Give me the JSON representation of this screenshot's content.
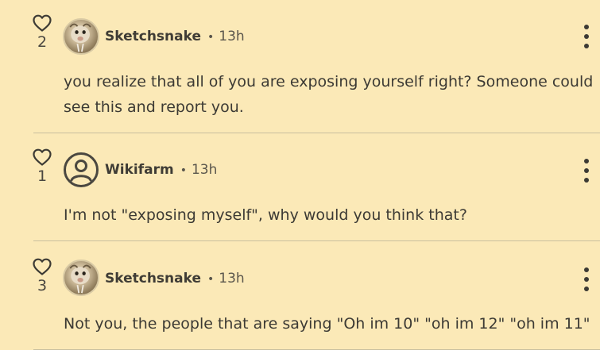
{
  "comments": [
    {
      "likes": "2",
      "avatar": "pet-photo-avatar",
      "username": "Sketchsnake",
      "separator": "•",
      "time": "13h",
      "text": " you realize that all of you are exposing yourself right? Someone could see this and report you.",
      "menu_icon": "more-vertical-icon"
    },
    {
      "likes": "1",
      "avatar": "default-user-avatar",
      "username": "Wikifarm",
      "separator": "•",
      "time": "13h",
      "text": "I'm not \"exposing myself\", why would you think that?",
      "menu_icon": "more-vertical-icon"
    },
    {
      "likes": "3",
      "avatar": "pet-photo-avatar",
      "username": "Sketchsnake",
      "separator": "•",
      "time": "13h",
      "text": "Not you, the people that are saying \"Oh im 10\" \"oh im 12\" \"oh im 11\"",
      "menu_icon": "more-vertical-icon"
    }
  ],
  "colors": {
    "background": "#fbe9b7",
    "text": "#3c3a34",
    "divider": "#c9bf9e"
  },
  "icons": {
    "like": "heart-outline-icon",
    "menu": "more-vertical-icon",
    "default_avatar": "user-circle-icon"
  }
}
